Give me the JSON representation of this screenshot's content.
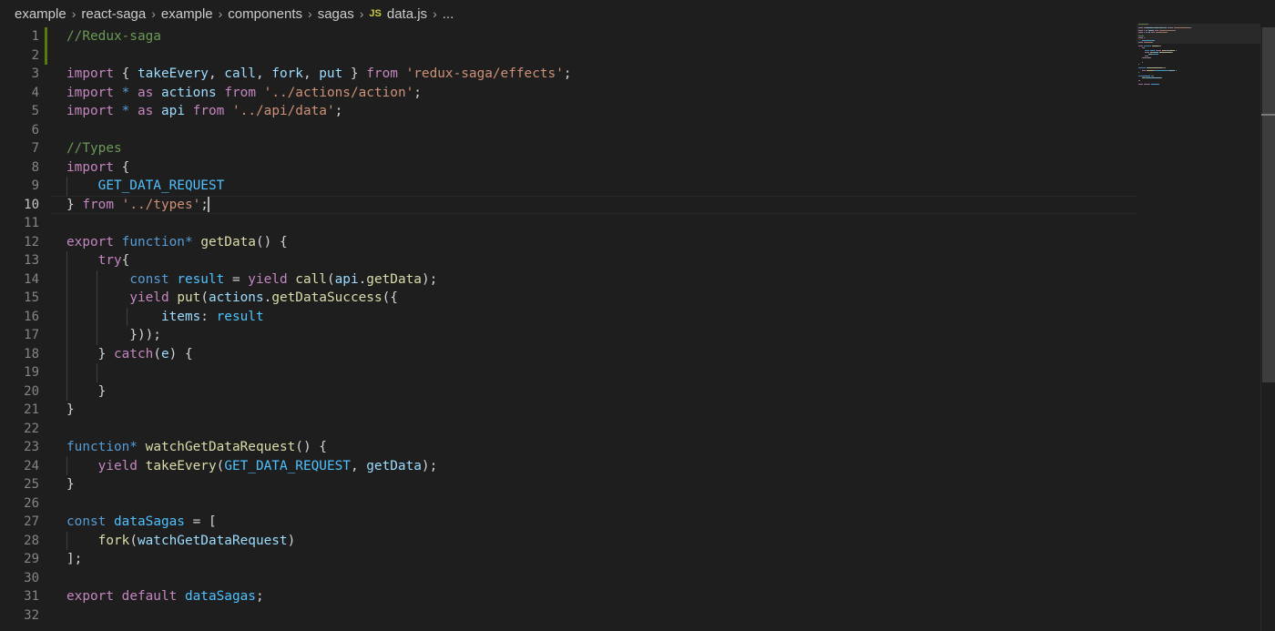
{
  "breadcrumb": {
    "items": [
      "example",
      "react-saga",
      "example",
      "components",
      "sagas"
    ],
    "file_badge": "JS",
    "file_name": "data.js",
    "ellipsis": "..."
  },
  "editor": {
    "active_line": 10,
    "lines": [
      {
        "n": "1",
        "indent": 0,
        "tokens": [
          [
            "cmt",
            "//Redux-saga"
          ]
        ]
      },
      {
        "n": "2",
        "indent": 0,
        "tokens": []
      },
      {
        "n": "3",
        "indent": 0,
        "tokens": [
          [
            "kw",
            "import"
          ],
          [
            "pun",
            " { "
          ],
          [
            "var",
            "takeEvery"
          ],
          [
            "pun",
            ", "
          ],
          [
            "var",
            "call"
          ],
          [
            "pun",
            ", "
          ],
          [
            "var",
            "fork"
          ],
          [
            "pun",
            ", "
          ],
          [
            "var",
            "put"
          ],
          [
            "pun",
            " } "
          ],
          [
            "kw",
            "from"
          ],
          [
            "pun",
            " "
          ],
          [
            "str",
            "'redux-saga/effects'"
          ],
          [
            "pun",
            ";"
          ]
        ]
      },
      {
        "n": "4",
        "indent": 0,
        "tokens": [
          [
            "kw",
            "import"
          ],
          [
            "pun",
            " "
          ],
          [
            "dkw",
            "*"
          ],
          [
            "pun",
            " "
          ],
          [
            "kw",
            "as"
          ],
          [
            "pun",
            " "
          ],
          [
            "var",
            "actions"
          ],
          [
            "pun",
            " "
          ],
          [
            "kw",
            "from"
          ],
          [
            "pun",
            " "
          ],
          [
            "str",
            "'../actions/action'"
          ],
          [
            "pun",
            ";"
          ]
        ]
      },
      {
        "n": "5",
        "indent": 0,
        "tokens": [
          [
            "kw",
            "import"
          ],
          [
            "pun",
            " "
          ],
          [
            "dkw",
            "*"
          ],
          [
            "pun",
            " "
          ],
          [
            "kw",
            "as"
          ],
          [
            "pun",
            " "
          ],
          [
            "var",
            "api"
          ],
          [
            "pun",
            " "
          ],
          [
            "kw",
            "from"
          ],
          [
            "pun",
            " "
          ],
          [
            "str",
            "'../api/data'"
          ],
          [
            "pun",
            ";"
          ]
        ]
      },
      {
        "n": "6",
        "indent": 0,
        "tokens": []
      },
      {
        "n": "7",
        "indent": 0,
        "tokens": [
          [
            "cmt",
            "//Types"
          ]
        ]
      },
      {
        "n": "8",
        "indent": 0,
        "tokens": [
          [
            "kw",
            "import"
          ],
          [
            "pun",
            " {"
          ]
        ]
      },
      {
        "n": "9",
        "indent": 1,
        "tokens": [
          [
            "pun",
            "    "
          ],
          [
            "cst",
            "GET_DATA_REQUEST"
          ]
        ]
      },
      {
        "n": "10",
        "indent": 0,
        "tokens": [
          [
            "pun",
            "} "
          ],
          [
            "kw",
            "from"
          ],
          [
            "pun",
            " "
          ],
          [
            "str",
            "'../types'"
          ],
          [
            "pun",
            ";"
          ]
        ],
        "cursor": true
      },
      {
        "n": "11",
        "indent": 0,
        "tokens": []
      },
      {
        "n": "12",
        "indent": 0,
        "tokens": [
          [
            "kw",
            "export"
          ],
          [
            "pun",
            " "
          ],
          [
            "dkw",
            "function*"
          ],
          [
            "pun",
            " "
          ],
          [
            "fn",
            "getData"
          ],
          [
            "pun",
            "() {"
          ]
        ]
      },
      {
        "n": "13",
        "indent": 1,
        "tokens": [
          [
            "pun",
            "    "
          ],
          [
            "kw",
            "try"
          ],
          [
            "pun",
            "{"
          ]
        ]
      },
      {
        "n": "14",
        "indent": 2,
        "tokens": [
          [
            "pun",
            "        "
          ],
          [
            "dkw",
            "const"
          ],
          [
            "pun",
            " "
          ],
          [
            "cst",
            "result"
          ],
          [
            "pun",
            " = "
          ],
          [
            "kw",
            "yield"
          ],
          [
            "pun",
            " "
          ],
          [
            "fn",
            "call"
          ],
          [
            "pun",
            "("
          ],
          [
            "var",
            "api"
          ],
          [
            "pun",
            "."
          ],
          [
            "fn",
            "getData"
          ],
          [
            "pun",
            ");"
          ]
        ]
      },
      {
        "n": "15",
        "indent": 2,
        "tokens": [
          [
            "pun",
            "        "
          ],
          [
            "kw",
            "yield"
          ],
          [
            "pun",
            " "
          ],
          [
            "fn",
            "put"
          ],
          [
            "pun",
            "("
          ],
          [
            "var",
            "actions"
          ],
          [
            "pun",
            "."
          ],
          [
            "fn",
            "getDataSuccess"
          ],
          [
            "pun",
            "({"
          ]
        ]
      },
      {
        "n": "16",
        "indent": 3,
        "tokens": [
          [
            "pun",
            "            "
          ],
          [
            "var",
            "items"
          ],
          [
            "pun",
            ": "
          ],
          [
            "cst",
            "result"
          ]
        ]
      },
      {
        "n": "17",
        "indent": 2,
        "tokens": [
          [
            "pun",
            "        }));"
          ]
        ]
      },
      {
        "n": "18",
        "indent": 1,
        "tokens": [
          [
            "pun",
            "    } "
          ],
          [
            "kw",
            "catch"
          ],
          [
            "pun",
            "("
          ],
          [
            "var",
            "e"
          ],
          [
            "pun",
            ") {"
          ]
        ]
      },
      {
        "n": "19",
        "indent": 2,
        "tokens": []
      },
      {
        "n": "20",
        "indent": 1,
        "tokens": [
          [
            "pun",
            "    }"
          ]
        ]
      },
      {
        "n": "21",
        "indent": 0,
        "tokens": [
          [
            "pun",
            "}"
          ]
        ]
      },
      {
        "n": "22",
        "indent": 0,
        "tokens": []
      },
      {
        "n": "23",
        "indent": 0,
        "tokens": [
          [
            "dkw",
            "function*"
          ],
          [
            "pun",
            " "
          ],
          [
            "fn",
            "watchGetDataRequest"
          ],
          [
            "pun",
            "() {"
          ]
        ]
      },
      {
        "n": "24",
        "indent": 1,
        "tokens": [
          [
            "pun",
            "    "
          ],
          [
            "kw",
            "yield"
          ],
          [
            "pun",
            " "
          ],
          [
            "fn",
            "takeEvery"
          ],
          [
            "pun",
            "("
          ],
          [
            "cst",
            "GET_DATA_REQUEST"
          ],
          [
            "pun",
            ", "
          ],
          [
            "var",
            "getData"
          ],
          [
            "pun",
            ");"
          ]
        ]
      },
      {
        "n": "25",
        "indent": 0,
        "tokens": [
          [
            "pun",
            "}"
          ]
        ]
      },
      {
        "n": "26",
        "indent": 0,
        "tokens": []
      },
      {
        "n": "27",
        "indent": 0,
        "tokens": [
          [
            "dkw",
            "const"
          ],
          [
            "pun",
            " "
          ],
          [
            "cst",
            "dataSagas"
          ],
          [
            "pun",
            " = ["
          ]
        ]
      },
      {
        "n": "28",
        "indent": 1,
        "tokens": [
          [
            "pun",
            "    "
          ],
          [
            "fn",
            "fork"
          ],
          [
            "pun",
            "("
          ],
          [
            "var",
            "watchGetDataRequest"
          ],
          [
            "pun",
            ")"
          ]
        ]
      },
      {
        "n": "29",
        "indent": 0,
        "tokens": [
          [
            "pun",
            "];"
          ]
        ]
      },
      {
        "n": "30",
        "indent": 0,
        "tokens": []
      },
      {
        "n": "31",
        "indent": 0,
        "tokens": [
          [
            "kw",
            "export"
          ],
          [
            "pun",
            " "
          ],
          [
            "kw",
            "default"
          ],
          [
            "pun",
            " "
          ],
          [
            "cst",
            "dataSagas"
          ],
          [
            "pun",
            ";"
          ]
        ]
      },
      {
        "n": "32",
        "indent": 0,
        "tokens": []
      }
    ]
  },
  "colors": {
    "background": "#1e1e1e",
    "comment": "#6a9955",
    "keyword_control": "#c586c0",
    "keyword_decl": "#569cd6",
    "variable": "#9cdcfe",
    "constant": "#4fc1ff",
    "function": "#dcdcaa",
    "string": "#ce9178",
    "modified_gutter": "#587c0c"
  }
}
